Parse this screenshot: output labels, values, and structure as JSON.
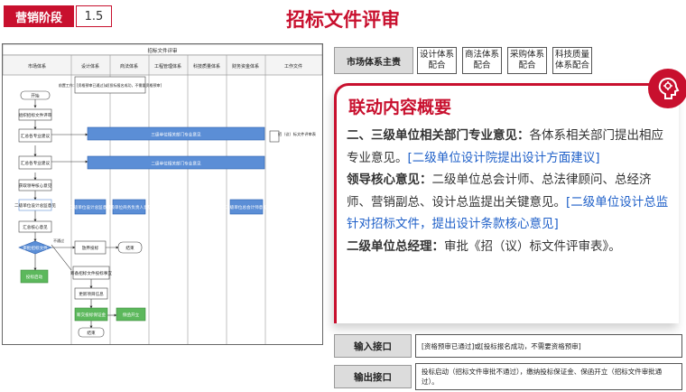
{
  "header": {
    "stage_label": "营销阶段",
    "stage_number": "1.5",
    "title": "招标文件评审"
  },
  "flowchart": {
    "title": "招标文件评审",
    "columns": [
      "市场体系",
      "设计体系",
      "商法体系",
      "工程管理体系",
      "科技质量体系",
      "财务资金体系",
      "工作文件"
    ],
    "nodes": {
      "start": "开始",
      "organize": "组织招标文件评审",
      "summarize1": "汇总各专业建议",
      "summarize2": "汇总各专业建议",
      "get_leader": "获取领导核心意见",
      "opinion_design": "二级单位设计总监意见",
      "opinion_design_sub": "二级单位设计总监意见",
      "opinion_law": "二级单位商务负责人意见",
      "opinion_fin": "二级单位总会计师意见",
      "summarize_core": "汇总核心意见",
      "approve": "审批招标文件",
      "bid": "放弃投标",
      "end1": "结束",
      "prepare": "筹备招标文件投标事宜",
      "update": "更新项目信息",
      "bid_start": "投标启动",
      "fin_margin": "筹交投标保证金",
      "fin_guarantee": "保函开立",
      "end2": "结束",
      "three_level_bar": "三级单位相关部门专业意见",
      "two_level_bar": "二级单位相关部门专业意见",
      "note": "前置工作：[资格预审已通过]或[投标报名成功，不需要资格预审]",
      "doc": "招（议）标文件评审表",
      "pass_label": "不通过"
    }
  },
  "systems": {
    "main": "市场体系主责",
    "partners": [
      "设计体系\n配合",
      "商法体系\n配合",
      "采购体系\n配合",
      "科技质量\n体系配合"
    ]
  },
  "content": {
    "title": "联动内容概要",
    "p1_bold": "二、三级单位相关部门专业意见：",
    "p1_text": "各体系相关部门提出相应专业意见。",
    "p1_blue": "[二级单位设计院提出设计方面建议]",
    "p2_bold": "领导核心意见：",
    "p2_text": "二级单位总会计师、总法律顾问、总经济师、营销副总、设计总监提出关键意见。",
    "p2_blue": "[二级单位设计总监针对招标文件，提出设计条款核心意见]",
    "p3_bold": "二级单位总经理：",
    "p3_text": "审批《招（议）标文件评审表》。"
  },
  "io": {
    "input_label": "输入接口",
    "input_text": "[资格预审已通过]或[投标报名成功，不需要资格预审]",
    "output_label": "输出接口",
    "output_text": "投标启动（招标文件审批不通过），缴纳投标保证金、保函开立（招标文件审批通过）。"
  },
  "colors": {
    "accent": "#c8102e",
    "flow_blue": "#5b8ed6",
    "flow_green": "#5cb85c",
    "link_blue": "#1e5fc8"
  },
  "icons": {
    "badge": "brain-head-icon"
  }
}
